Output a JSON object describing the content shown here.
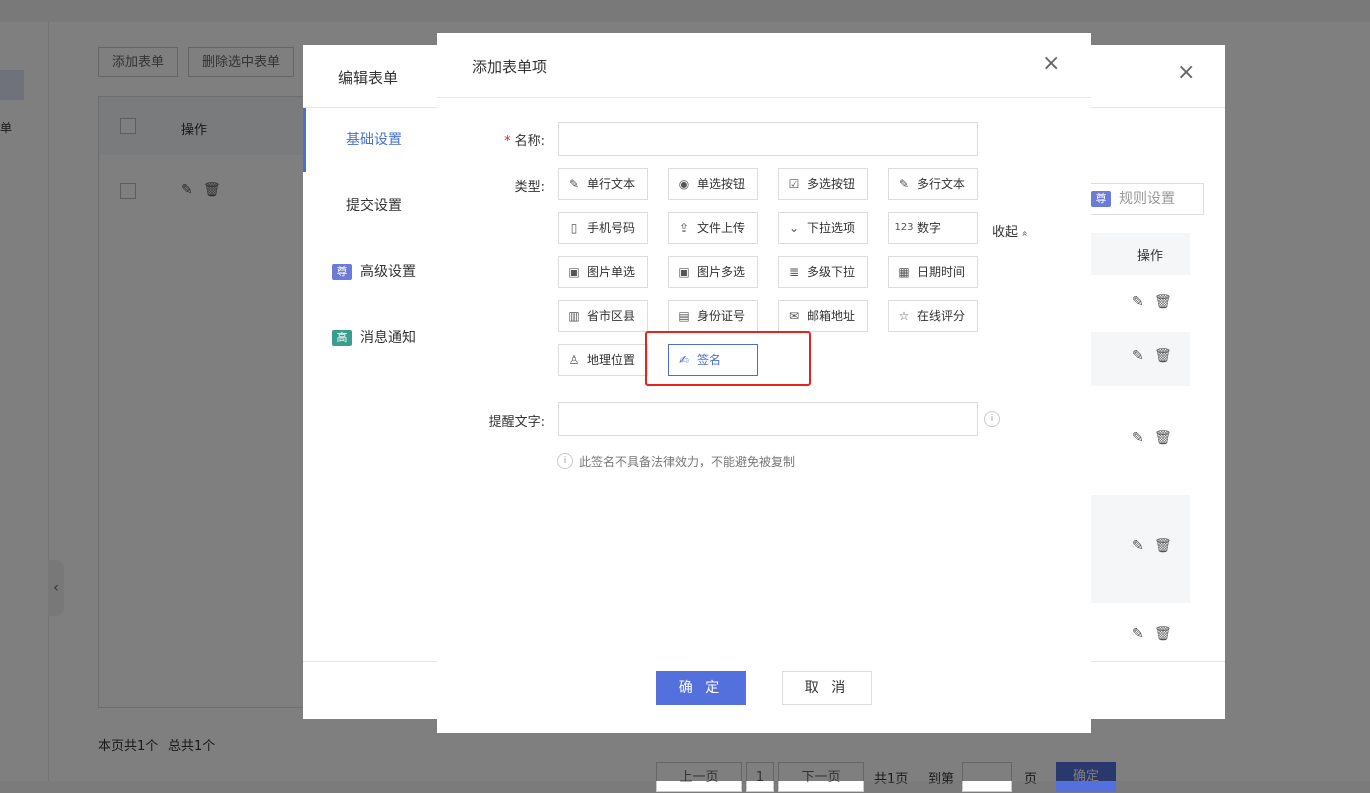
{
  "background": {
    "nav_items": [
      "单"
    ],
    "toolbar": {
      "add_form": "添加表单",
      "delete_selected": "删除选中表单"
    },
    "table": {
      "col_operation": "操作"
    },
    "footer": {
      "page_count": "本页共1个",
      "total_count": "总共1个"
    },
    "pager": {
      "prev": "上一页",
      "page": "1",
      "next": "下一页",
      "total_pages": "共1页",
      "goto": "到第",
      "page_unit": "页",
      "confirm": "确定"
    },
    "collapse_arrow": "‹"
  },
  "edit_dialog": {
    "title": "编辑表单",
    "close": "×",
    "tabs": [
      {
        "label": "基础设置",
        "badge": ""
      },
      {
        "label": "提交设置",
        "badge": ""
      },
      {
        "label": "高级设置",
        "badge": "尊"
      },
      {
        "label": "消息通知",
        "badge": "高"
      }
    ],
    "rule_settings": {
      "badge": "尊",
      "label": "规则设置"
    },
    "col_operation": "操作",
    "colors": {
      "badge_purple": "#6b7bd6",
      "badge_teal": "#3a9e8f"
    }
  },
  "add_dialog": {
    "title": "添加表单项",
    "close": "×",
    "name_label": "名称:",
    "name_value": "",
    "type_label": "类型:",
    "types": [
      {
        "label": "单行文本",
        "icon": "✎"
      },
      {
        "label": "单选按钮",
        "icon": "◉"
      },
      {
        "label": "多选按钮",
        "icon": "☑"
      },
      {
        "label": "多行文本",
        "icon": "✎"
      },
      {
        "label": "手机号码",
        "icon": "▯"
      },
      {
        "label": "文件上传",
        "icon": "⇪"
      },
      {
        "label": "下拉选项",
        "icon": "⌄"
      },
      {
        "label": "数字",
        "icon": "123"
      },
      {
        "label": "图片单选",
        "icon": "▣"
      },
      {
        "label": "图片多选",
        "icon": "▣"
      },
      {
        "label": "多级下拉",
        "icon": "≣"
      },
      {
        "label": "日期时间",
        "icon": "▦"
      },
      {
        "label": "省市区县",
        "icon": "▥"
      },
      {
        "label": "身份证号",
        "icon": "▤"
      },
      {
        "label": "邮箱地址",
        "icon": "✉"
      },
      {
        "label": "在线评分",
        "icon": "☆"
      },
      {
        "label": "地理位置",
        "icon": "♙"
      },
      {
        "label": "签名",
        "icon": "✍"
      }
    ],
    "selected_type": "签名",
    "collapse_label": "收起",
    "collapse_icon": "»",
    "hint_label": "提醒文字:",
    "hint_value": "",
    "hint_info_icon": "i",
    "notice_icon": "i",
    "notice": "此签名不具备法律效力，不能避免被复制",
    "confirm": "确 定",
    "cancel": "取 消",
    "colors": {
      "primary": "#5470dc",
      "highlight_box": "#e8231b",
      "required": "#e02020"
    }
  }
}
